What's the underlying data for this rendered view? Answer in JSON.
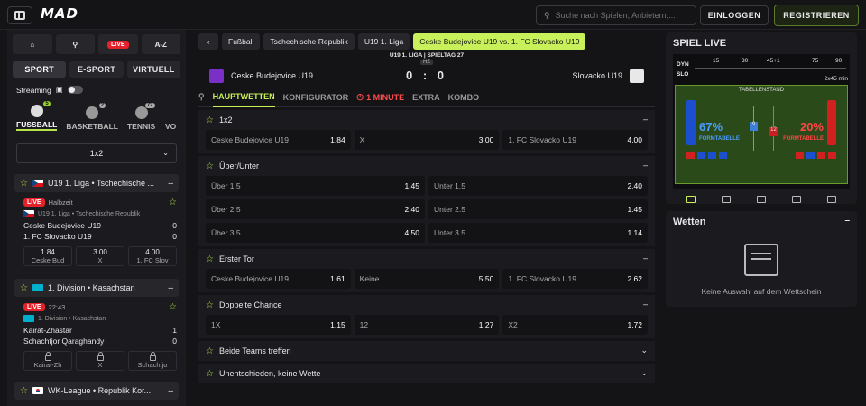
{
  "header": {
    "logo": "MAD",
    "search_placeholder": "Suche nach Spielen, Anbietern,...",
    "login": "EINLOGGEN",
    "register": "REGISTRIEREN"
  },
  "sidebar": {
    "top_tabs": [
      "A-Z"
    ],
    "live_badge": "LIVE",
    "sport_tabs": [
      "SPORT",
      "E-SPORT",
      "VIRTUELL"
    ],
    "streaming_label": "Streaming",
    "sports": [
      {
        "label": "FUSSBALL",
        "count": "5"
      },
      {
        "label": "BASKETBALL",
        "count": "2"
      },
      {
        "label": "TENNIS",
        "count": "72"
      },
      {
        "label": "VO",
        "count": ""
      }
    ],
    "market_select": "1x2",
    "leagues": [
      {
        "title": "U19 1. Liga • Tschechische ...",
        "match": {
          "live": "LIVE",
          "status": "Halbzeit",
          "league_line": "U19 1. Liga • Tschechische Republik",
          "home": "Ceske Budejovice U19",
          "home_score": "0",
          "away": "1. FC Slovacko U19",
          "away_score": "0",
          "odds": [
            {
              "value": "1.84",
              "label": "Ceske Bud"
            },
            {
              "value": "3.00",
              "label": "X"
            },
            {
              "value": "4.00",
              "label": "1. FC Slov"
            }
          ]
        }
      },
      {
        "title": "1. Division • Kasachstan",
        "match": {
          "live": "LIVE",
          "status": "22:43",
          "league_line": "1. Division • Kasachstan",
          "home": "Kairat-Zhastar",
          "home_score": "1",
          "away": "Schachtjor Qaraghandy",
          "away_score": "0",
          "odds": [
            {
              "label": "Kairat-Zh"
            },
            {
              "label": "X"
            },
            {
              "label": "Schachtjo"
            }
          ]
        }
      },
      {
        "title": "WK-League • Republik Kor..."
      }
    ]
  },
  "center": {
    "breadcrumbs": [
      "Fußball",
      "Tschechische Republik",
      "U19 1. Liga",
      "Ceske Budejovice U19 vs. 1. FC Slovacko U19"
    ],
    "match_header": {
      "league_line": "U19 1. LIGA | SPIELTAG 27",
      "minute": "HZ",
      "home": "Ceske Budejovice U19",
      "away": "Slovacko U19",
      "score": "0 : 0"
    },
    "tabs": [
      "HAUPTWETTEN",
      "KONFIGURATOR",
      "1 MINUTE",
      "EXTRA",
      "KOMBO"
    ],
    "markets": [
      {
        "title": "1x2",
        "rows": [
          [
            {
              "label": "Ceske Budejovice U19",
              "odd": "1.84"
            },
            {
              "label": "X",
              "odd": "3.00"
            },
            {
              "label": "1. FC Slovacko U19",
              "odd": "4.00"
            }
          ]
        ]
      },
      {
        "title": "Über/Unter",
        "rows": [
          [
            {
              "label": "Über 1.5",
              "odd": "1.45"
            },
            {
              "label": "Unter 1.5",
              "odd": "2.40"
            }
          ],
          [
            {
              "label": "Über 2.5",
              "odd": "2.40"
            },
            {
              "label": "Unter 2.5",
              "odd": "1.45"
            }
          ],
          [
            {
              "label": "Über 3.5",
              "odd": "4.50"
            },
            {
              "label": "Unter 3.5",
              "odd": "1.14"
            }
          ]
        ]
      },
      {
        "title": "Erster Tor",
        "rows": [
          [
            {
              "label": "Ceske Budejovice U19",
              "odd": "1.61"
            },
            {
              "label": "Keine",
              "odd": "5.50"
            },
            {
              "label": "1. FC Slovacko U19",
              "odd": "2.62"
            }
          ]
        ]
      },
      {
        "title": "Doppelte Chance",
        "rows": [
          [
            {
              "label": "1X",
              "odd": "1.15"
            },
            {
              "label": "12",
              "odd": "1.27"
            },
            {
              "label": "X2",
              "odd": "1.72"
            }
          ]
        ]
      },
      {
        "title": "Beide Teams treffen",
        "rows": []
      },
      {
        "title": "Unentschieden, keine Wette",
        "rows": []
      }
    ]
  },
  "right": {
    "live_title": "SPIEL LIVE",
    "dyn_labels": [
      "DYN",
      "SLO"
    ],
    "dyn_ticks": [
      "15",
      "30",
      "45+1",
      "75",
      "90"
    ],
    "dyn_duration": "2x45 min",
    "table_title": "TABELLENSTAND",
    "left_pct": "67%",
    "right_pct": "20%",
    "form_label": "FORMTABELLE",
    "left_rank": "9",
    "right_rank": "12",
    "wetten_title": "Wetten",
    "empty_text": "Keine Auswahl auf dem Wettschein"
  }
}
